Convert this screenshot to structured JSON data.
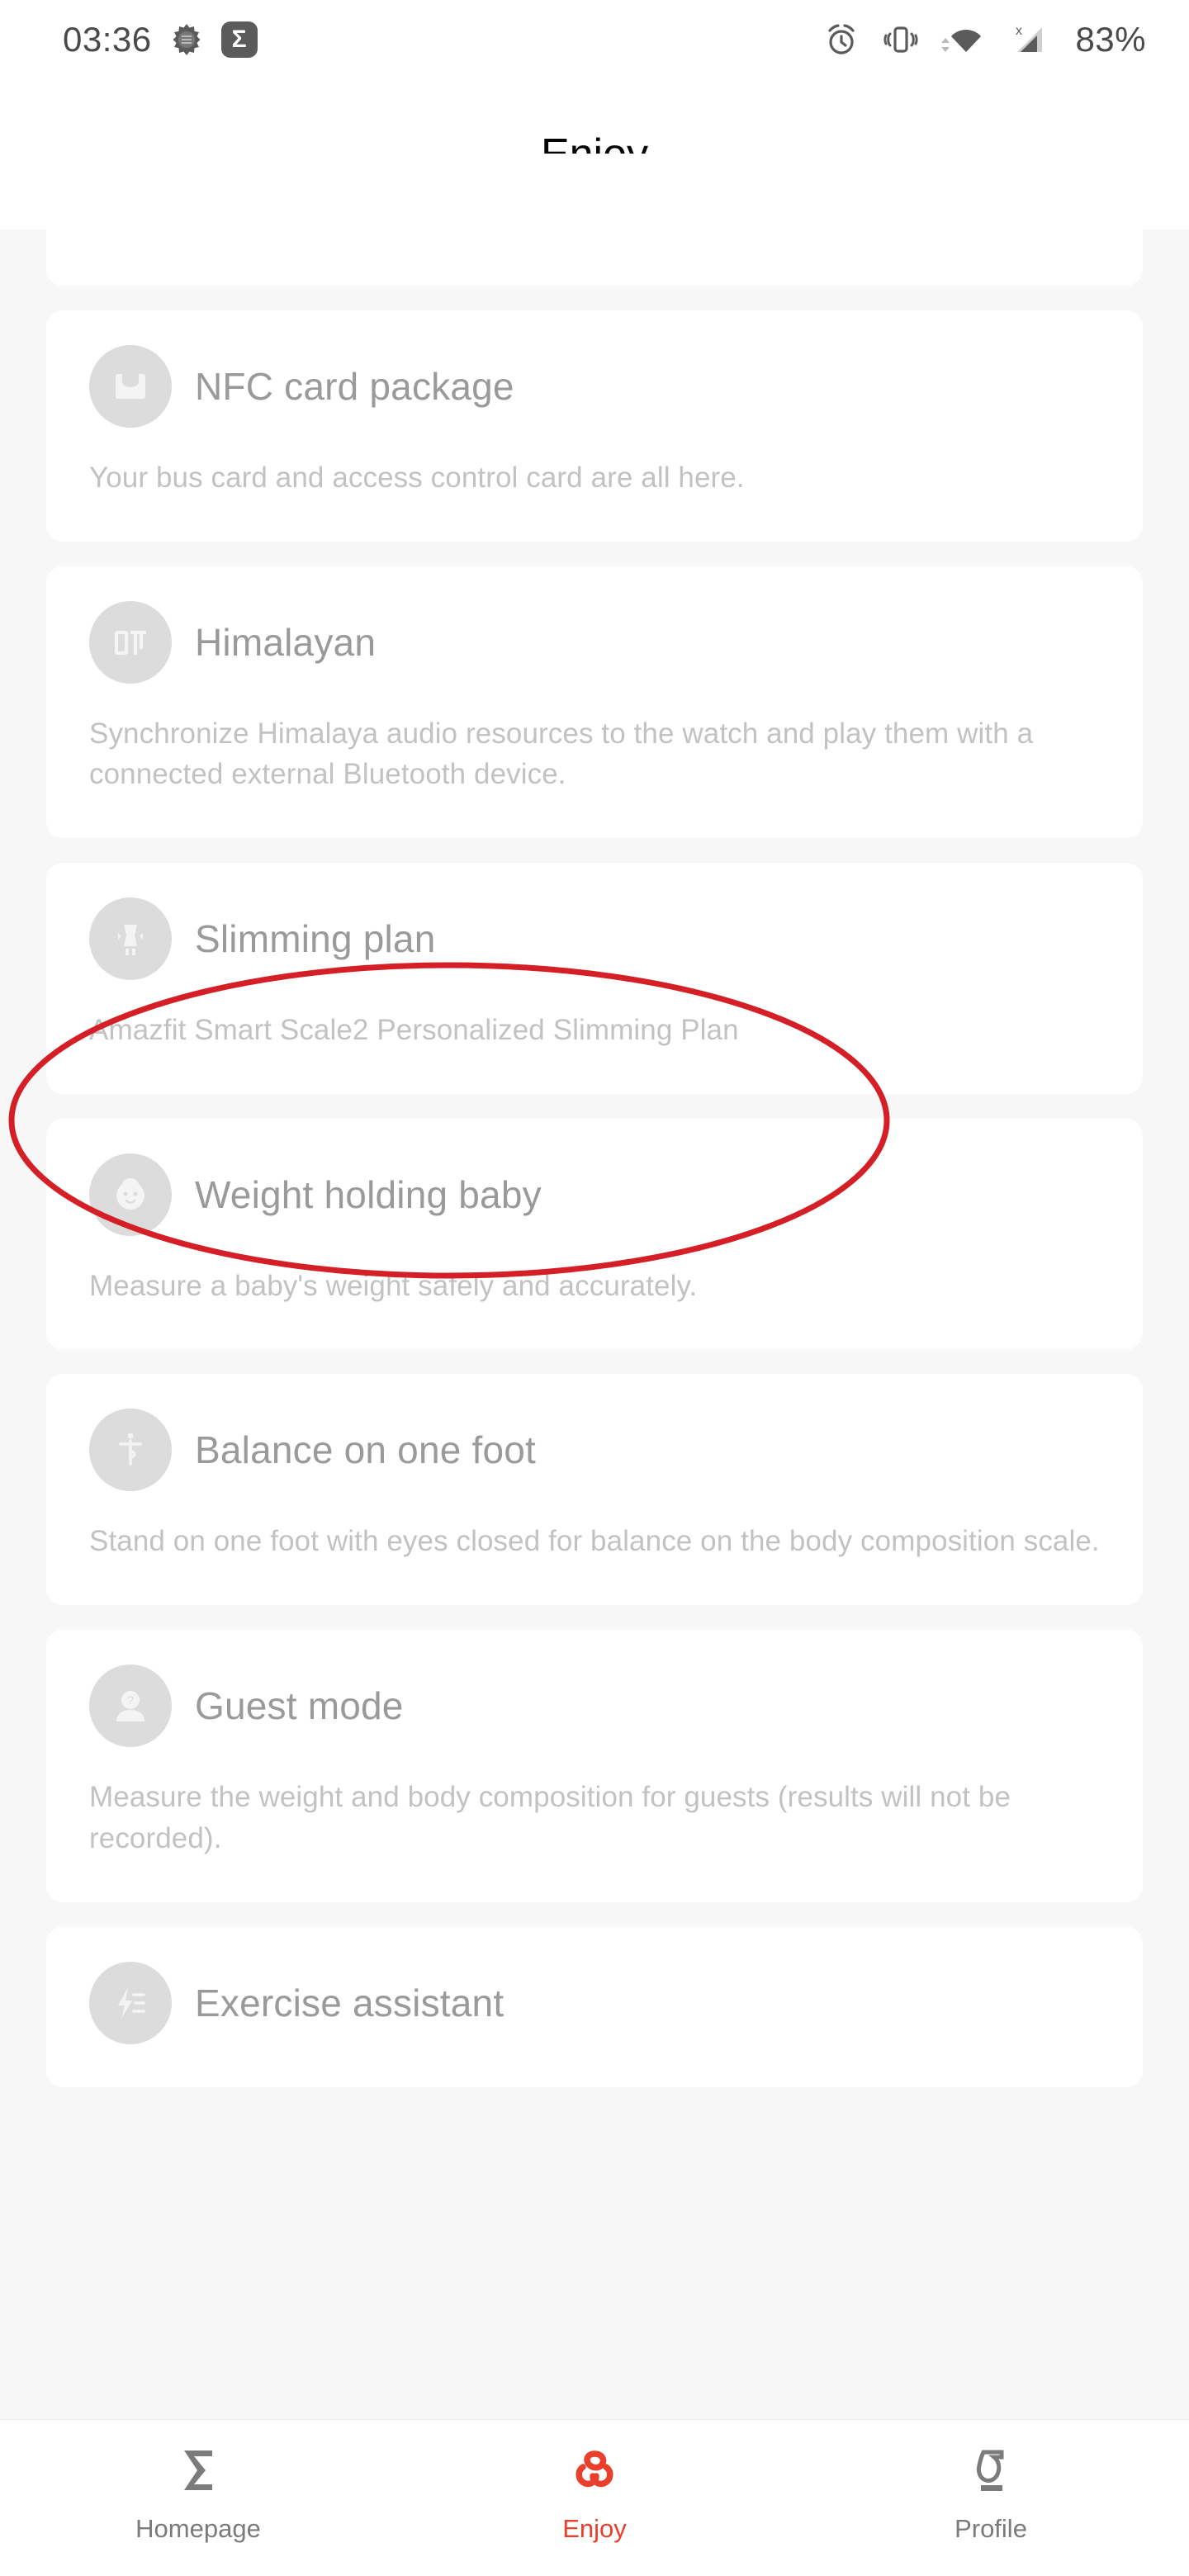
{
  "statusbar": {
    "time": "03:36",
    "battery": "83%",
    "icons": {
      "quran": "quran-icon",
      "app_badge": "Σ",
      "alarm": "alarm-icon",
      "vibrate": "vibrate-icon",
      "wifi": "wifi-icon",
      "signal": "signal-no-sim-icon"
    }
  },
  "header": {
    "title": "Enjoy"
  },
  "cards": [
    {
      "title": "NFC card package",
      "desc": "Your bus card and access control card are all here.",
      "icon": "nfc-wallet-icon"
    },
    {
      "title": "Himalayan",
      "desc": "Synchronize Himalaya audio resources to the watch and play them with a connected external Bluetooth device.",
      "icon": "himalaya-logo-icon"
    },
    {
      "title": "Slimming plan",
      "desc": "Amazfit Smart Scale2 Personalized Slimming Plan",
      "icon": "slimming-body-icon",
      "highlighted": true
    },
    {
      "title": "Weight holding baby",
      "desc": "Measure a baby's weight safely and accurately.",
      "icon": "baby-face-icon"
    },
    {
      "title": "Balance on one foot",
      "desc": "Stand on one foot with eyes closed for balance on the body composition scale.",
      "icon": "standing-person-icon"
    },
    {
      "title": "Guest mode",
      "desc": "Measure the weight and body composition for guests (results will not be recorded).",
      "icon": "guest-avatar-icon"
    },
    {
      "title": "Exercise assistant",
      "desc": "",
      "icon": "lightning-list-icon"
    }
  ],
  "bottom_nav": [
    {
      "label": "Homepage",
      "icon": "sigma-icon",
      "active": false
    },
    {
      "label": "Enjoy",
      "icon": "zepp-knot-icon",
      "active": true
    },
    {
      "label": "Profile",
      "icon": "profile-sigma-icon",
      "active": false
    }
  ],
  "annotation": {
    "shape": "ellipse",
    "color": "#d41f26",
    "target": "Slimming plan"
  },
  "colors": {
    "accent_red": "#e8402c",
    "annotation_red": "#d41f26",
    "page_bg": "#f7f7f7",
    "card_bg": "#ffffff",
    "title_grey": "#9a9a9a",
    "desc_grey": "#c2c2c2",
    "icon_bg_grey": "#dcdcdc"
  }
}
